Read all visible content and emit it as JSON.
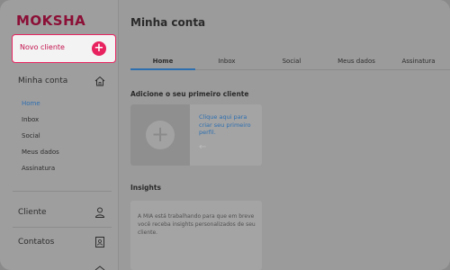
{
  "sidebar": {
    "logo": "MOKSHA",
    "new_client_label": "Novo cliente",
    "sections": [
      {
        "label": "Minha conta",
        "icon": "home-icon"
      },
      {
        "label": "Cliente",
        "icon": "user-icon"
      },
      {
        "label": "Contatos",
        "icon": "contacts-book-icon"
      }
    ],
    "sub_items": [
      {
        "label": "Home",
        "active": true
      },
      {
        "label": "Inbox"
      },
      {
        "label": "Social"
      },
      {
        "label": "Meus dados"
      },
      {
        "label": "Assinatura"
      }
    ]
  },
  "main": {
    "title": "Minha conta",
    "tabs": [
      {
        "label": "Home",
        "active": true
      },
      {
        "label": "Inbox"
      },
      {
        "label": "Social"
      },
      {
        "label": "Meus dados"
      },
      {
        "label": "Assinatura"
      }
    ],
    "add_section_title": "Adicione o seu primeiro cliente",
    "add_card_cta": "Clique aqui para criar seu primeiro perfil.",
    "insights_title": "Insights",
    "insights_text": "A MIA está trabalhando para que em breve você receba insights personalizados de seu cliente."
  },
  "colors": {
    "brand": "#8b0f36",
    "accent": "#e8225f",
    "link": "#2e6fb0"
  }
}
